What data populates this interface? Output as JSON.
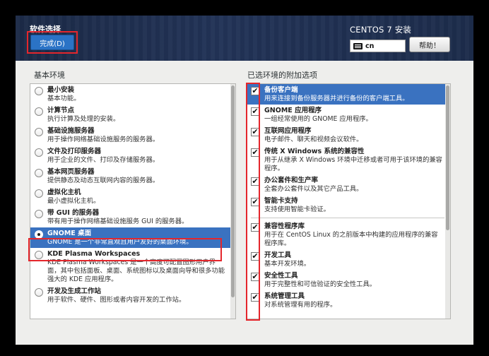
{
  "header": {
    "spoke_title": "软件选择",
    "done_label": "完成(D)",
    "product_title": "CENTOS 7 安装",
    "keyboard_layout": "cn",
    "help_label": "帮助！"
  },
  "base_environment": {
    "label": "基本环境",
    "items": [
      {
        "name": "最小安装",
        "desc": "基本功能。",
        "selected": false
      },
      {
        "name": "计算节点",
        "desc": "执行计算及处理的安装。",
        "selected": false
      },
      {
        "name": "基础设施服务器",
        "desc": "用于操作网络基础设施服务的服务器。",
        "selected": false
      },
      {
        "name": "文件及打印服务器",
        "desc": "用于企业的文件、打印及存储服务器。",
        "selected": false
      },
      {
        "name": "基本网页服务器",
        "desc": "提供静态及动态互联网内容的服务器。",
        "selected": false
      },
      {
        "name": "虚拟化主机",
        "desc": "最小虚拟化主机。",
        "selected": false
      },
      {
        "name": "带 GUI 的服务器",
        "desc": "带有用于操作网络基础设施服务 GUI 的服务器。",
        "selected": false
      },
      {
        "name": "GNOME 桌面",
        "desc": "GNOME 是一个非常直观且用户友好的桌面环境。",
        "selected": true
      },
      {
        "name": "KDE Plasma Workspaces",
        "desc": "KDE Plasma Workspaces 是一个高度可配置图形用户界面，其中包括面板、桌面、系统图标以及桌面向导和很多功能强大的 KDE 应用程序。",
        "selected": false
      },
      {
        "name": "开发及生成工作站",
        "desc": "用于软件、硬件、图形或者内容开发的工作站。",
        "selected": false
      }
    ]
  },
  "addons": {
    "label": "已选环境的附加选项",
    "items": [
      {
        "name": "备份客户端",
        "desc": "用来连接到备份服务器并进行备份的客户端工具。",
        "checked": true,
        "highlighted": true
      },
      {
        "name": "GNOME 应用程序",
        "desc": "一组经常使用的 GNOME 应用程序。",
        "checked": true
      },
      {
        "name": "互联网应用程序",
        "desc": "电子邮件、聊天和视频会议软件。",
        "checked": true
      },
      {
        "name": "传统 X Windows 系统的兼容性",
        "desc": "用于从继承 X Windows 环境中迁移或者可用于该环境的兼容程序。",
        "checked": true
      },
      {
        "name": "办公套件和生产率",
        "desc": "全套办公套件以及其它产品工具。",
        "checked": true
      },
      {
        "name": "智能卡支持",
        "desc": "支持使用智能卡验证。",
        "checked": true
      },
      {
        "name": "兼容性程序库",
        "desc": "用于在 CentOS Linux 的之前版本中构建的应用程序的兼容程序库。",
        "checked": true,
        "divider_before": true
      },
      {
        "name": "开发工具",
        "desc": "基本开发环境。",
        "checked": true
      },
      {
        "name": "安全性工具",
        "desc": "用于完整性和可信验证的安全性工具。",
        "checked": true
      },
      {
        "name": "系统管理工具",
        "desc": "对系统管理有用的程序。",
        "checked": true
      }
    ]
  },
  "icons": {
    "check": "✔"
  }
}
